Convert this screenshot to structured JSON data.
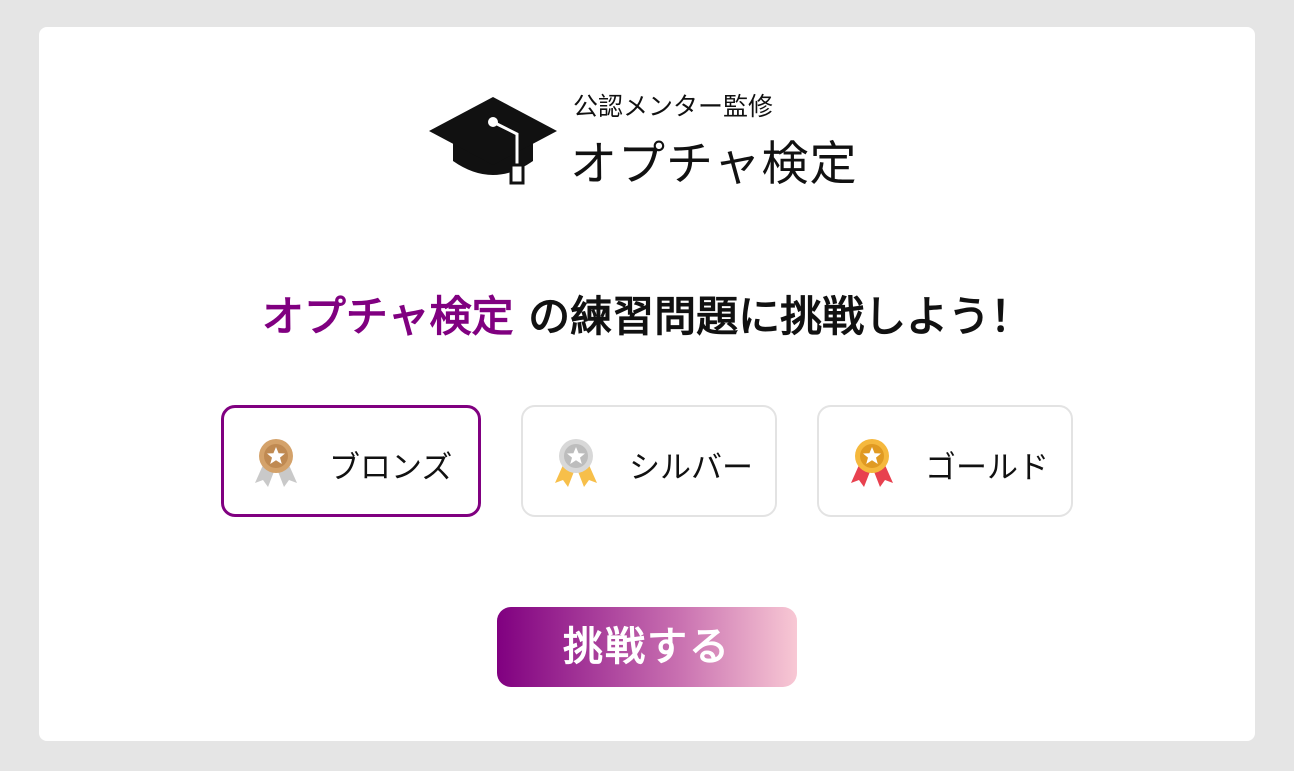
{
  "logo": {
    "icon": "graduation-cap-icon",
    "subtitle": "公認メンター監修",
    "title": "オプチャ検定"
  },
  "heading": {
    "accent": "オプチャ検定",
    "rest": " の練習問題に挑戦しよう！"
  },
  "levels": [
    {
      "label": "ブロンズ",
      "icon": "bronze-medal-icon",
      "selected": true
    },
    {
      "label": "シルバー",
      "icon": "silver-medal-icon",
      "selected": false
    },
    {
      "label": "ゴールド",
      "icon": "gold-medal-icon",
      "selected": false
    }
  ],
  "cta": {
    "label": "挑戦する"
  },
  "colors": {
    "accent": "#800080",
    "background": "#e5e5e5",
    "card": "#ffffff",
    "border": "#e3e3e3",
    "gradient_end": "#f8c8d4"
  }
}
